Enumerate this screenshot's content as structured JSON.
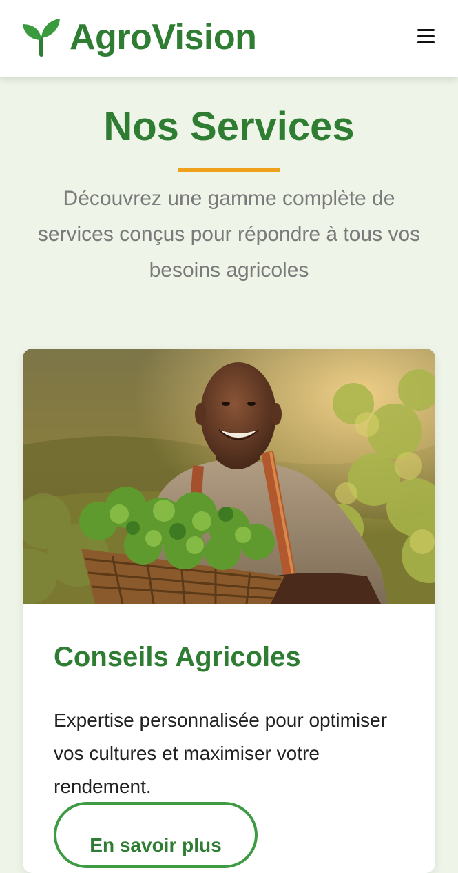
{
  "header": {
    "brand": "AgroVision",
    "logo_icon": "sprout-icon",
    "menu_icon": "hamburger-menu-icon"
  },
  "services": {
    "title": "Nos Services",
    "description": "Découvrez une gamme complète de services conçus pour répondre à tous vos besoins agricoles"
  },
  "card": {
    "image_alt": "Agriculteur souriant tenant un panier de légumes verts",
    "title": "Conseils Agricoles",
    "text": "Expertise personnalisée pour optimiser vos cultures et maximiser votre rendement.",
    "button_label": "En savoir plus"
  },
  "colors": {
    "brand_green": "#2e7d32",
    "accent_orange": "#f0a11c",
    "page_background": "#eef4e8"
  }
}
